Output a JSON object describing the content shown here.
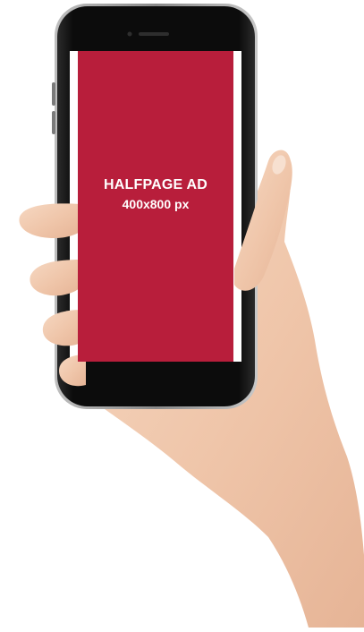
{
  "ad": {
    "title": "HALFPAGE AD",
    "size": "400x800 px",
    "color": "#b81e3b"
  },
  "phone": {
    "color": "#121212",
    "bezel_color": "#ffffff"
  },
  "hand": {
    "skin_color": "#f2cdb3"
  }
}
